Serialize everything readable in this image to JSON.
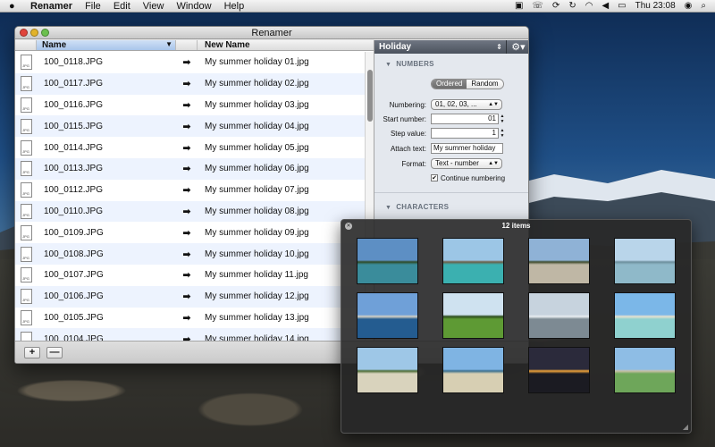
{
  "menubar": {
    "app": "Renamer",
    "menus": [
      "File",
      "Edit",
      "View",
      "Window",
      "Help"
    ],
    "clock": "Thu 23:08"
  },
  "window": {
    "title": "Renamer",
    "columns": {
      "name": "Name",
      "new_name": "New Name"
    },
    "rows": [
      {
        "name": "100_0118.JPG",
        "new_name": "My summer holiday 01.jpg"
      },
      {
        "name": "100_0117.JPG",
        "new_name": "My summer holiday 02.jpg"
      },
      {
        "name": "100_0116.JPG",
        "new_name": "My summer holiday 03.jpg"
      },
      {
        "name": "100_0115.JPG",
        "new_name": "My summer holiday 04.jpg"
      },
      {
        "name": "100_0114.JPG",
        "new_name": "My summer holiday 05.jpg"
      },
      {
        "name": "100_0113.JPG",
        "new_name": "My summer holiday 06.jpg"
      },
      {
        "name": "100_0112.JPG",
        "new_name": "My summer holiday 07.jpg"
      },
      {
        "name": "100_0110.JPG",
        "new_name": "My summer holiday 08.jpg"
      },
      {
        "name": "100_0109.JPG",
        "new_name": "My summer holiday 09.jpg"
      },
      {
        "name": "100_0108.JPG",
        "new_name": "My summer holiday 10.jpg"
      },
      {
        "name": "100_0107.JPG",
        "new_name": "My summer holiday 11.jpg"
      },
      {
        "name": "100_0106.JPG",
        "new_name": "My summer holiday 12.jpg"
      },
      {
        "name": "100_0105.JPG",
        "new_name": "My summer holiday 13.jpg"
      },
      {
        "name": "100_0104.JPG",
        "new_name": "My summer holiday 14.jpg"
      }
    ],
    "add_label": "+",
    "remove_label": "—"
  },
  "inspector": {
    "preset": "Holiday",
    "numbers_section": "NUMBERS",
    "seg_ordered": "Ordered",
    "seg_random": "Random",
    "numbering_label": "Numbering:",
    "numbering_value": "01, 02, 03, ...",
    "start_label": "Start number:",
    "start_value": "01",
    "step_label": "Step value:",
    "step_value": "1",
    "attach_label": "Attach text:",
    "attach_value": "My summer holiday",
    "format_label": "Format:",
    "format_value": "Text - number",
    "continue_label": "Continue numbering",
    "continue_checked": true,
    "characters_section": "CHARACTERS"
  },
  "hud": {
    "title": "12 items",
    "images": [
      {
        "name": "palm-beach-jetty",
        "sky": "#5d8fc4",
        "ground": "#3a8c9b",
        "accent": "#2e4a25"
      },
      {
        "name": "turquoise-water-posts",
        "sky": "#9cc6e6",
        "ground": "#3bb0b0",
        "accent": "#6e5d44"
      },
      {
        "name": "resort-deck",
        "sky": "#8fb2d6",
        "ground": "#bfb7a5",
        "accent": "#3c4a2c"
      },
      {
        "name": "glass-railing-sea",
        "sky": "#b9d5ea",
        "ground": "#8fb9c9",
        "accent": "#6d8e9c"
      },
      {
        "name": "harbor-skyline",
        "sky": "#6fa0d8",
        "ground": "#245c90",
        "accent": "#d7d2c5"
      },
      {
        "name": "palm-lawn",
        "sky": "#cfe2f0",
        "ground": "#5e9a34",
        "accent": "#2b4b1d"
      },
      {
        "name": "waves-spray",
        "sky": "#c7d3de",
        "ground": "#7d8a93",
        "accent": "#ecf0f3"
      },
      {
        "name": "island-lagoon",
        "sky": "#7bb7e8",
        "ground": "#8fd1cf",
        "accent": "#e9e2cf"
      },
      {
        "name": "beach-house",
        "sky": "#9ec7e7",
        "ground": "#d9d3bd",
        "accent": "#4c6b35"
      },
      {
        "name": "palm-shoreline",
        "sky": "#7fb4e3",
        "ground": "#d7cfb3",
        "accent": "#3a6f8e"
      },
      {
        "name": "sunset-sea",
        "sky": "#2b2a3b",
        "ground": "#1b1b22",
        "accent": "#f0a43a"
      },
      {
        "name": "hotel-lawn",
        "sky": "#8ebde5",
        "ground": "#6ea65a",
        "accent": "#c9c0a8"
      }
    ]
  }
}
